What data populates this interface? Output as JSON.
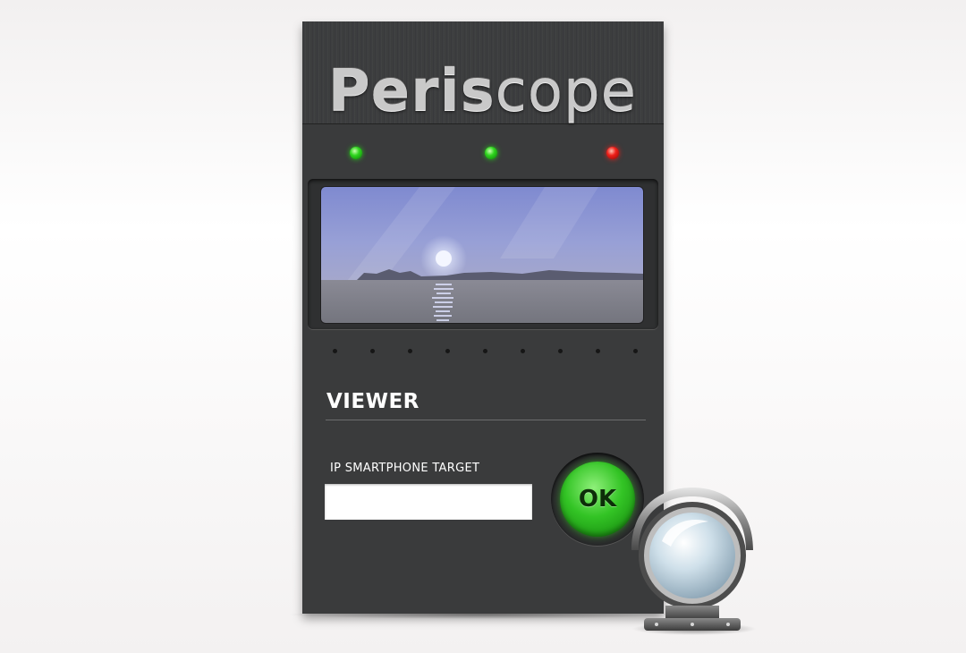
{
  "app": {
    "title_bold": "Peris",
    "title_light": "cope"
  },
  "leds": [
    {
      "status": "on",
      "color": "#2fd51e"
    },
    {
      "status": "on",
      "color": "#2fd51e"
    },
    {
      "status": "alert",
      "color": "#f0201a"
    }
  ],
  "viewer": {
    "section_title": "VIEWER",
    "ip_label": "IP SMARTPHONE TARGET",
    "ip_value": "",
    "ok_label": "OK"
  },
  "icons": {
    "lens": "periscope-lens-icon"
  },
  "colors": {
    "panel": "#3a3b3c",
    "accent_green": "#33c425",
    "screen_sky": "#8f98d8"
  }
}
